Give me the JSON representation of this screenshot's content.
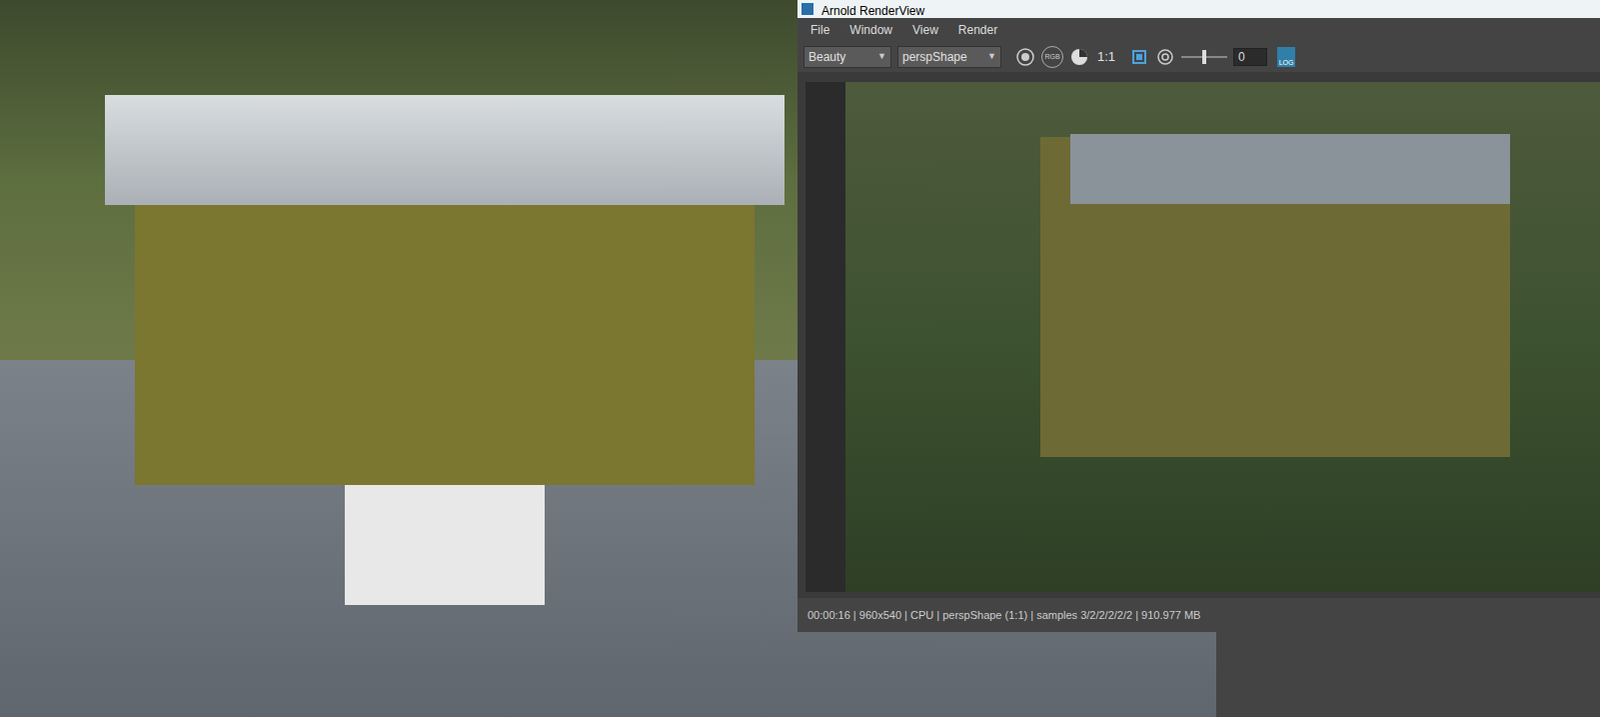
{
  "window": {
    "title": "Arnold RenderView"
  },
  "menu": [
    "File",
    "Window",
    "View",
    "Render"
  ],
  "toolbar": {
    "aov": "Beauty",
    "camera": "perspShape",
    "rgb_label": "RGB",
    "ratio": "1:1",
    "exposure": {
      "level": 0.5,
      "reading": "0"
    },
    "log_label": "LOG"
  },
  "status_bar": "00:00:16 | 960x540 | CPU | perspShape (1:1) | samples 3/2/2/2/2/2 | 910.977 MB"
}
